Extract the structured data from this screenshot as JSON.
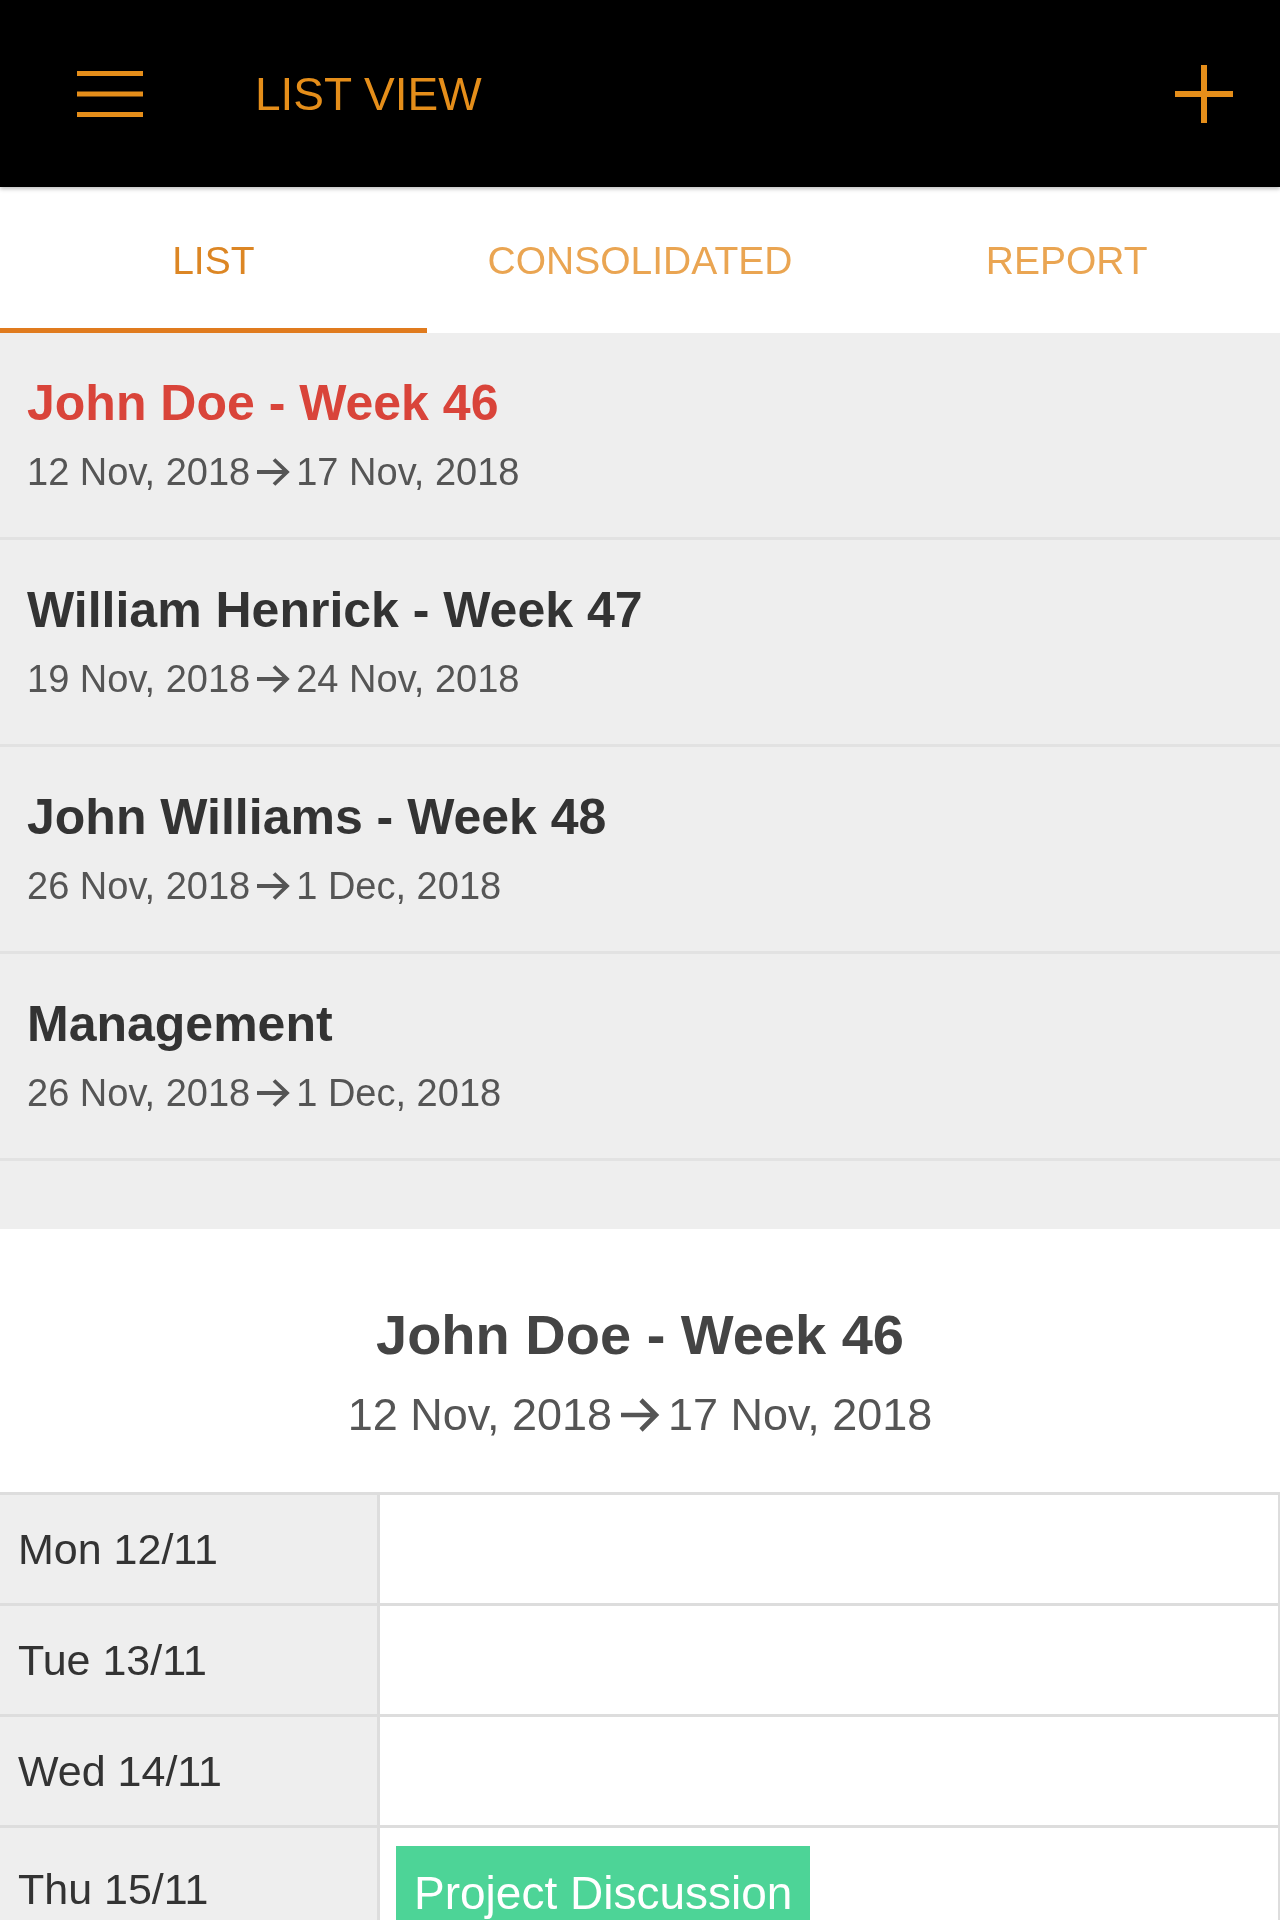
{
  "app_bar": {
    "title": "LIST VIEW"
  },
  "tabs": [
    {
      "label": "LIST",
      "selected": true
    },
    {
      "label": "CONSOLIDATED",
      "selected": false
    },
    {
      "label": "REPORT",
      "selected": false
    }
  ],
  "timesheets": [
    {
      "title": "John Doe - Week 46",
      "start": "12 Nov, 2018",
      "end": "17 Nov, 2018",
      "selected": true
    },
    {
      "title": "William Henrick - Week 47",
      "start": "19 Nov, 2018",
      "end": "24 Nov, 2018",
      "selected": false
    },
    {
      "title": "John Williams - Week 48",
      "start": "26 Nov, 2018",
      "end": "1 Dec, 2018",
      "selected": false
    },
    {
      "title": "Management",
      "start": "26 Nov, 2018",
      "end": "1 Dec, 2018",
      "selected": false
    }
  ],
  "detail": {
    "title": "John Doe - Week 46",
    "start": "12 Nov, 2018",
    "end": "17 Nov, 2018",
    "days": [
      {
        "label": "Mon 12/11"
      },
      {
        "label": "Tue 13/11"
      },
      {
        "label": "Wed 14/11"
      },
      {
        "label": "Thu 15/11",
        "events": [
          {
            "label": "Project Discussion",
            "color": "#4dd497"
          }
        ]
      }
    ]
  }
}
